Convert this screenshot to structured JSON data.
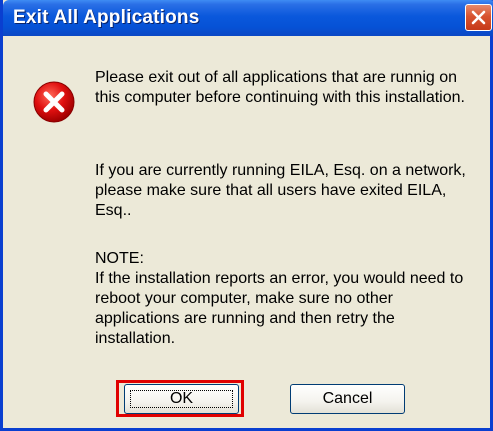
{
  "dialog": {
    "title": "Exit All Applications",
    "icon": "error-icon",
    "paragraphs": [
      "Please exit out of all applications that are runnig on this computer before continuing with this installation.",
      "If you are currently running EILA, Esq. on a network, please make sure that all users have exited EILA, Esq..",
      "NOTE:"
    ],
    "note_text": "If the installation reports an error, you would need to reboot your computer, make sure no other applications are running and then retry the installation.",
    "buttons": {
      "ok": "OK",
      "cancel": "Cancel"
    }
  },
  "colors": {
    "titlebar": "#0a58dc",
    "close_button": "#d8532f",
    "error_icon": "#d40000",
    "highlight": "#e00000",
    "window_bg": "#ece9d8"
  }
}
